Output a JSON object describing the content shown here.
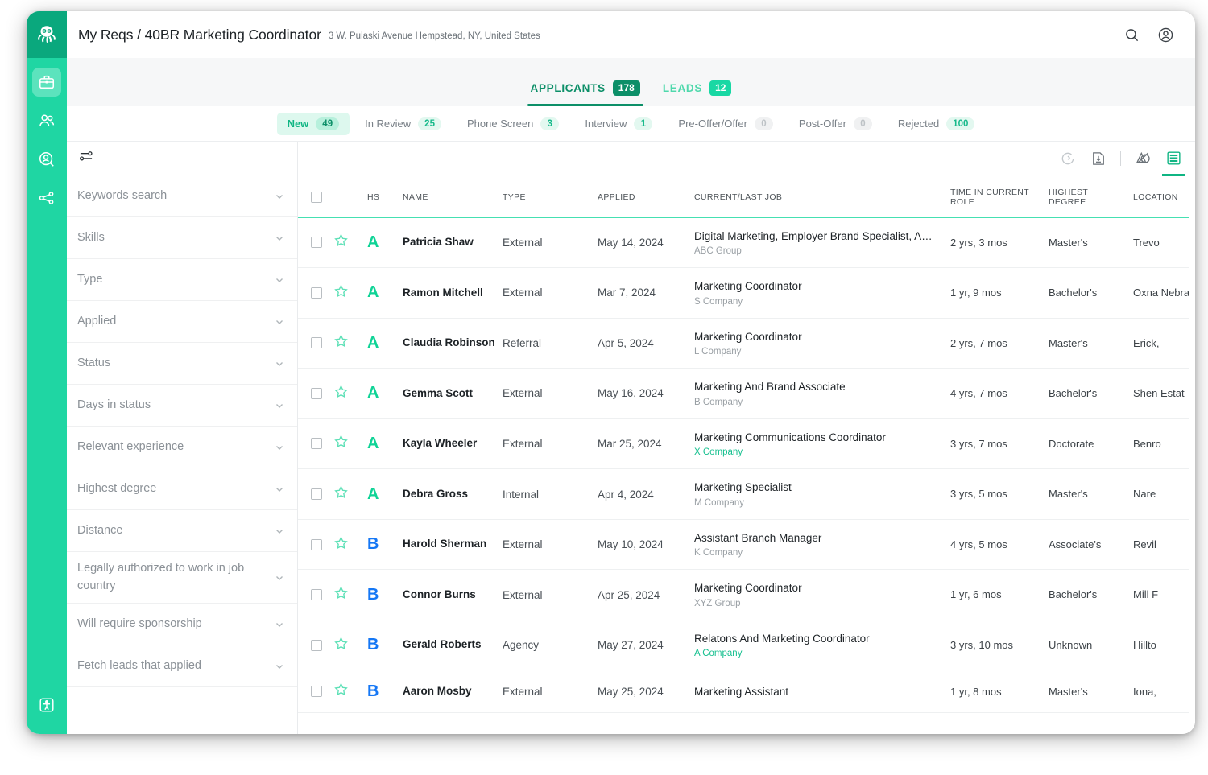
{
  "header": {
    "title": "My Reqs / 40BR Marketing Coordinator",
    "subtitle": "3 W. Pulaski Avenue Hempstead, NY, United States",
    "search_icon": "search-icon",
    "account_icon": "user-account-icon"
  },
  "rail": {
    "logo": "octopus-logo",
    "items": [
      {
        "icon": "briefcase-icon",
        "active": true
      },
      {
        "icon": "people-icon",
        "active": false
      },
      {
        "icon": "person-search-icon",
        "active": false
      },
      {
        "icon": "network-share-icon",
        "active": false
      }
    ],
    "bottom": {
      "icon": "accessibility-icon"
    }
  },
  "main_tabs": [
    {
      "label": "APPLICANTS",
      "count": "178",
      "selected": true
    },
    {
      "label": "LEADS",
      "count": "12",
      "selected": false
    }
  ],
  "status_tabs": [
    {
      "label": "New",
      "count": "49",
      "active": true,
      "zero": false
    },
    {
      "label": "In Review",
      "count": "25",
      "active": false,
      "zero": false
    },
    {
      "label": "Phone Screen",
      "count": "3",
      "active": false,
      "zero": false
    },
    {
      "label": "Interview",
      "count": "1",
      "active": false,
      "zero": false
    },
    {
      "label": "Pre-Offer/Offer",
      "count": "0",
      "active": false,
      "zero": true
    },
    {
      "label": "Post-Offer",
      "count": "0",
      "active": false,
      "zero": true
    },
    {
      "label": "Rejected",
      "count": "100",
      "active": false,
      "zero": false
    }
  ],
  "filters": {
    "panel_icon": "filter-sliders-icon",
    "items": [
      {
        "label": "Keywords search"
      },
      {
        "label": "Skills"
      },
      {
        "label": "Type"
      },
      {
        "label": "Applied"
      },
      {
        "label": "Status"
      },
      {
        "label": "Days in status"
      },
      {
        "label": "Relevant experience"
      },
      {
        "label": "Highest degree"
      },
      {
        "label": "Distance"
      },
      {
        "label": "Legally authorized to work in job country"
      },
      {
        "label": "Will require sponsorship"
      },
      {
        "label": "Fetch leads that applied"
      }
    ]
  },
  "table_tools": [
    {
      "icon": "refresh-icon"
    },
    {
      "icon": "download-icon"
    },
    {
      "icon": "divider"
    },
    {
      "icon": "compare-shapes-icon"
    },
    {
      "icon": "list-view-icon",
      "selected": true
    }
  ],
  "table": {
    "columns": [
      "",
      "HS",
      "NAME",
      "TYPE",
      "APPLIED",
      "CURRENT/LAST JOB",
      "TIME IN CURRENT ROLE",
      "HIGHEST DEGREE",
      "LOCATION"
    ],
    "rows": [
      {
        "grade": "A",
        "grade_color": "green",
        "name": "Patricia Shaw",
        "type": "External",
        "applied": "May 14, 2024",
        "job": "Digital Marketing, Employer Brand Specialist, A…",
        "company": "ABC Group",
        "company_link": false,
        "time_in_role": "2 yrs, 3 mos",
        "degree": "Master's",
        "location": "Trevo"
      },
      {
        "grade": "A",
        "grade_color": "green",
        "name": "Ramon Mitchell",
        "type": "External",
        "applied": "Mar 7, 2024",
        "job": "Marketing Coordinator",
        "company": "S Company",
        "company_link": false,
        "time_in_role": "1 yr, 9 mos",
        "degree": "Bachelor's",
        "location": "Oxna Nebra"
      },
      {
        "grade": "A",
        "grade_color": "green",
        "name": "Claudia Robinson",
        "type": "Referral",
        "applied": "Apr 5, 2024",
        "job": "Marketing Coordinator",
        "company": "L Company",
        "company_link": false,
        "time_in_role": "2 yrs, 7 mos",
        "degree": "Master's",
        "location": "Erick,"
      },
      {
        "grade": "A",
        "grade_color": "green",
        "name": "Gemma Scott",
        "type": "External",
        "applied": "May 16, 2024",
        "job": "Marketing And Brand Associate",
        "company": "B Company",
        "company_link": false,
        "time_in_role": "4 yrs, 7 mos",
        "degree": "Bachelor's",
        "location": "Shen Estat"
      },
      {
        "grade": "A",
        "grade_color": "green",
        "name": "Kayla Wheeler",
        "type": "External",
        "applied": "Mar 25, 2024",
        "job": "Marketing Communications Coordinator",
        "company": "X Company",
        "company_link": true,
        "time_in_role": "3 yrs, 7 mos",
        "degree": "Doctorate",
        "location": "Benro"
      },
      {
        "grade": "A",
        "grade_color": "green",
        "name": "Debra Gross",
        "type": "Internal",
        "applied": "Apr 4, 2024",
        "job": "Marketing Specialist",
        "company": "M Company",
        "company_link": false,
        "time_in_role": "3 yrs, 5 mos",
        "degree": "Master's",
        "location": "Nare"
      },
      {
        "grade": "B",
        "grade_color": "blue",
        "name": "Harold Sherman",
        "type": "External",
        "applied": "May 10, 2024",
        "job": "Assistant Branch Manager",
        "company": "K Company",
        "company_link": false,
        "time_in_role": "4 yrs, 5 mos",
        "degree": "Associate's",
        "location": "Revil"
      },
      {
        "grade": "B",
        "grade_color": "blue",
        "name": "Connor Burns",
        "type": "External",
        "applied": "Apr 25, 2024",
        "job": "Marketing Coordinator",
        "company": "XYZ Group",
        "company_link": false,
        "time_in_role": "1 yr, 6 mos",
        "degree": "Bachelor's",
        "location": "Mill F"
      },
      {
        "grade": "B",
        "grade_color": "blue",
        "name": "Gerald Roberts",
        "type": "Agency",
        "applied": "May 27, 2024",
        "job": "Relatons And Marketing Coordinator",
        "company": "A Company",
        "company_link": true,
        "time_in_role": "3 yrs, 10 mos",
        "degree": "Unknown",
        "location": "Hillto"
      },
      {
        "grade": "B",
        "grade_color": "blue",
        "name": "Aaron Mosby",
        "type": "External",
        "applied": "May 25, 2024",
        "job": "Marketing Assistant",
        "company": "",
        "company_link": false,
        "time_in_role": "1 yr, 8 mos",
        "degree": "Master's",
        "location": "Iona,"
      }
    ]
  },
  "colors": {
    "brand_green": "#1fd6a3",
    "brand_green_dark": "#0aa87d",
    "accent_green": "#0c8f68",
    "grade_a": "#0fd396",
    "grade_b": "#1577f5"
  }
}
